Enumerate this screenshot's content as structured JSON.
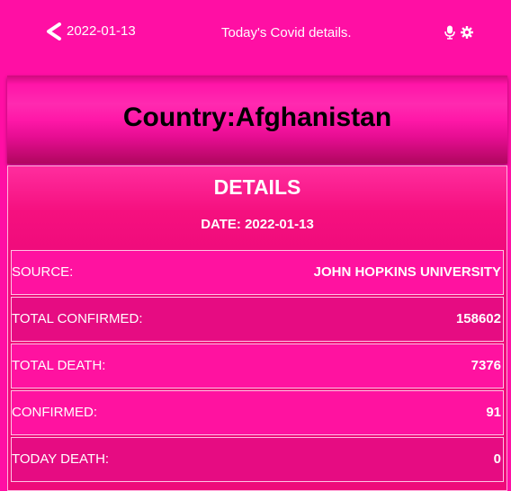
{
  "header": {
    "date": "2022-01-13",
    "title": "Today's Covid details."
  },
  "country": {
    "title": "Country:Afghanistan"
  },
  "details": {
    "heading": "DETAILS",
    "date_line": "DATE: 2022-01-13",
    "rows": [
      {
        "label": "SOURCE:",
        "value": "JOHN HOPKINS UNIVERSITY"
      },
      {
        "label": "TOTAL CONFIRMED:",
        "value": "158602"
      },
      {
        "label": "TOTAL DEATH:",
        "value": "7376"
      },
      {
        "label": "CONFIRMED:",
        "value": "91"
      },
      {
        "label": "TODAY DEATH:",
        "value": "0"
      }
    ]
  },
  "icons": {
    "back": "chevron-left-icon",
    "mic": "microphone-icon",
    "settings": "gear-icon"
  }
}
